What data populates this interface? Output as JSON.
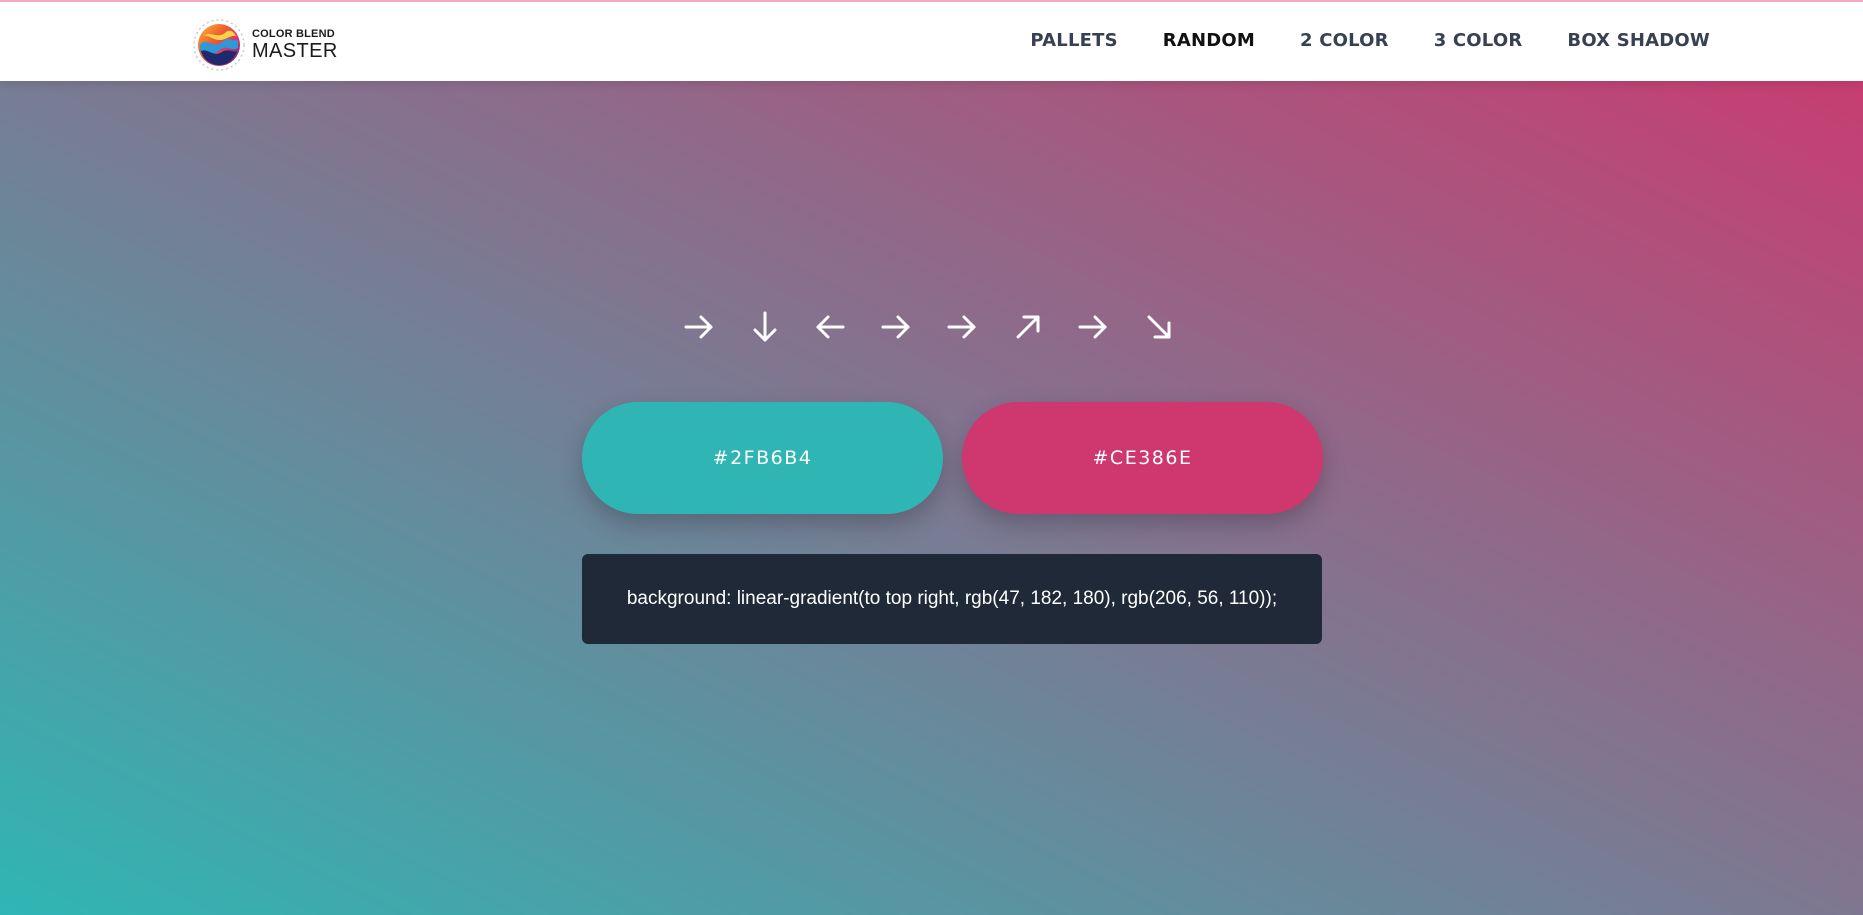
{
  "logo": {
    "line1": "COLOR BLEND",
    "line2": "MASTER"
  },
  "nav": {
    "items": [
      {
        "label": "PALLETS",
        "active": false
      },
      {
        "label": "RANDOM",
        "active": true
      },
      {
        "label": "2 COLOR",
        "active": false
      },
      {
        "label": "3 COLOR",
        "active": false
      },
      {
        "label": "BOX SHADOW",
        "active": false
      }
    ]
  },
  "direction_arrows": [
    "arrow-right-icon",
    "arrow-down-icon",
    "arrow-left-icon",
    "arrow-right-icon",
    "arrow-right-icon",
    "arrow-up-right-icon",
    "arrow-right-icon",
    "arrow-down-right-icon"
  ],
  "colors": {
    "color1": {
      "hex_label": "#2FB6B4",
      "value": "#2FB6B4"
    },
    "color2": {
      "hex_label": "#CE386E",
      "value": "#CE386E"
    }
  },
  "gradient": {
    "css_text": "background: linear-gradient(to top right, rgb(47, 182, 180), rgb(206, 56, 110));"
  }
}
